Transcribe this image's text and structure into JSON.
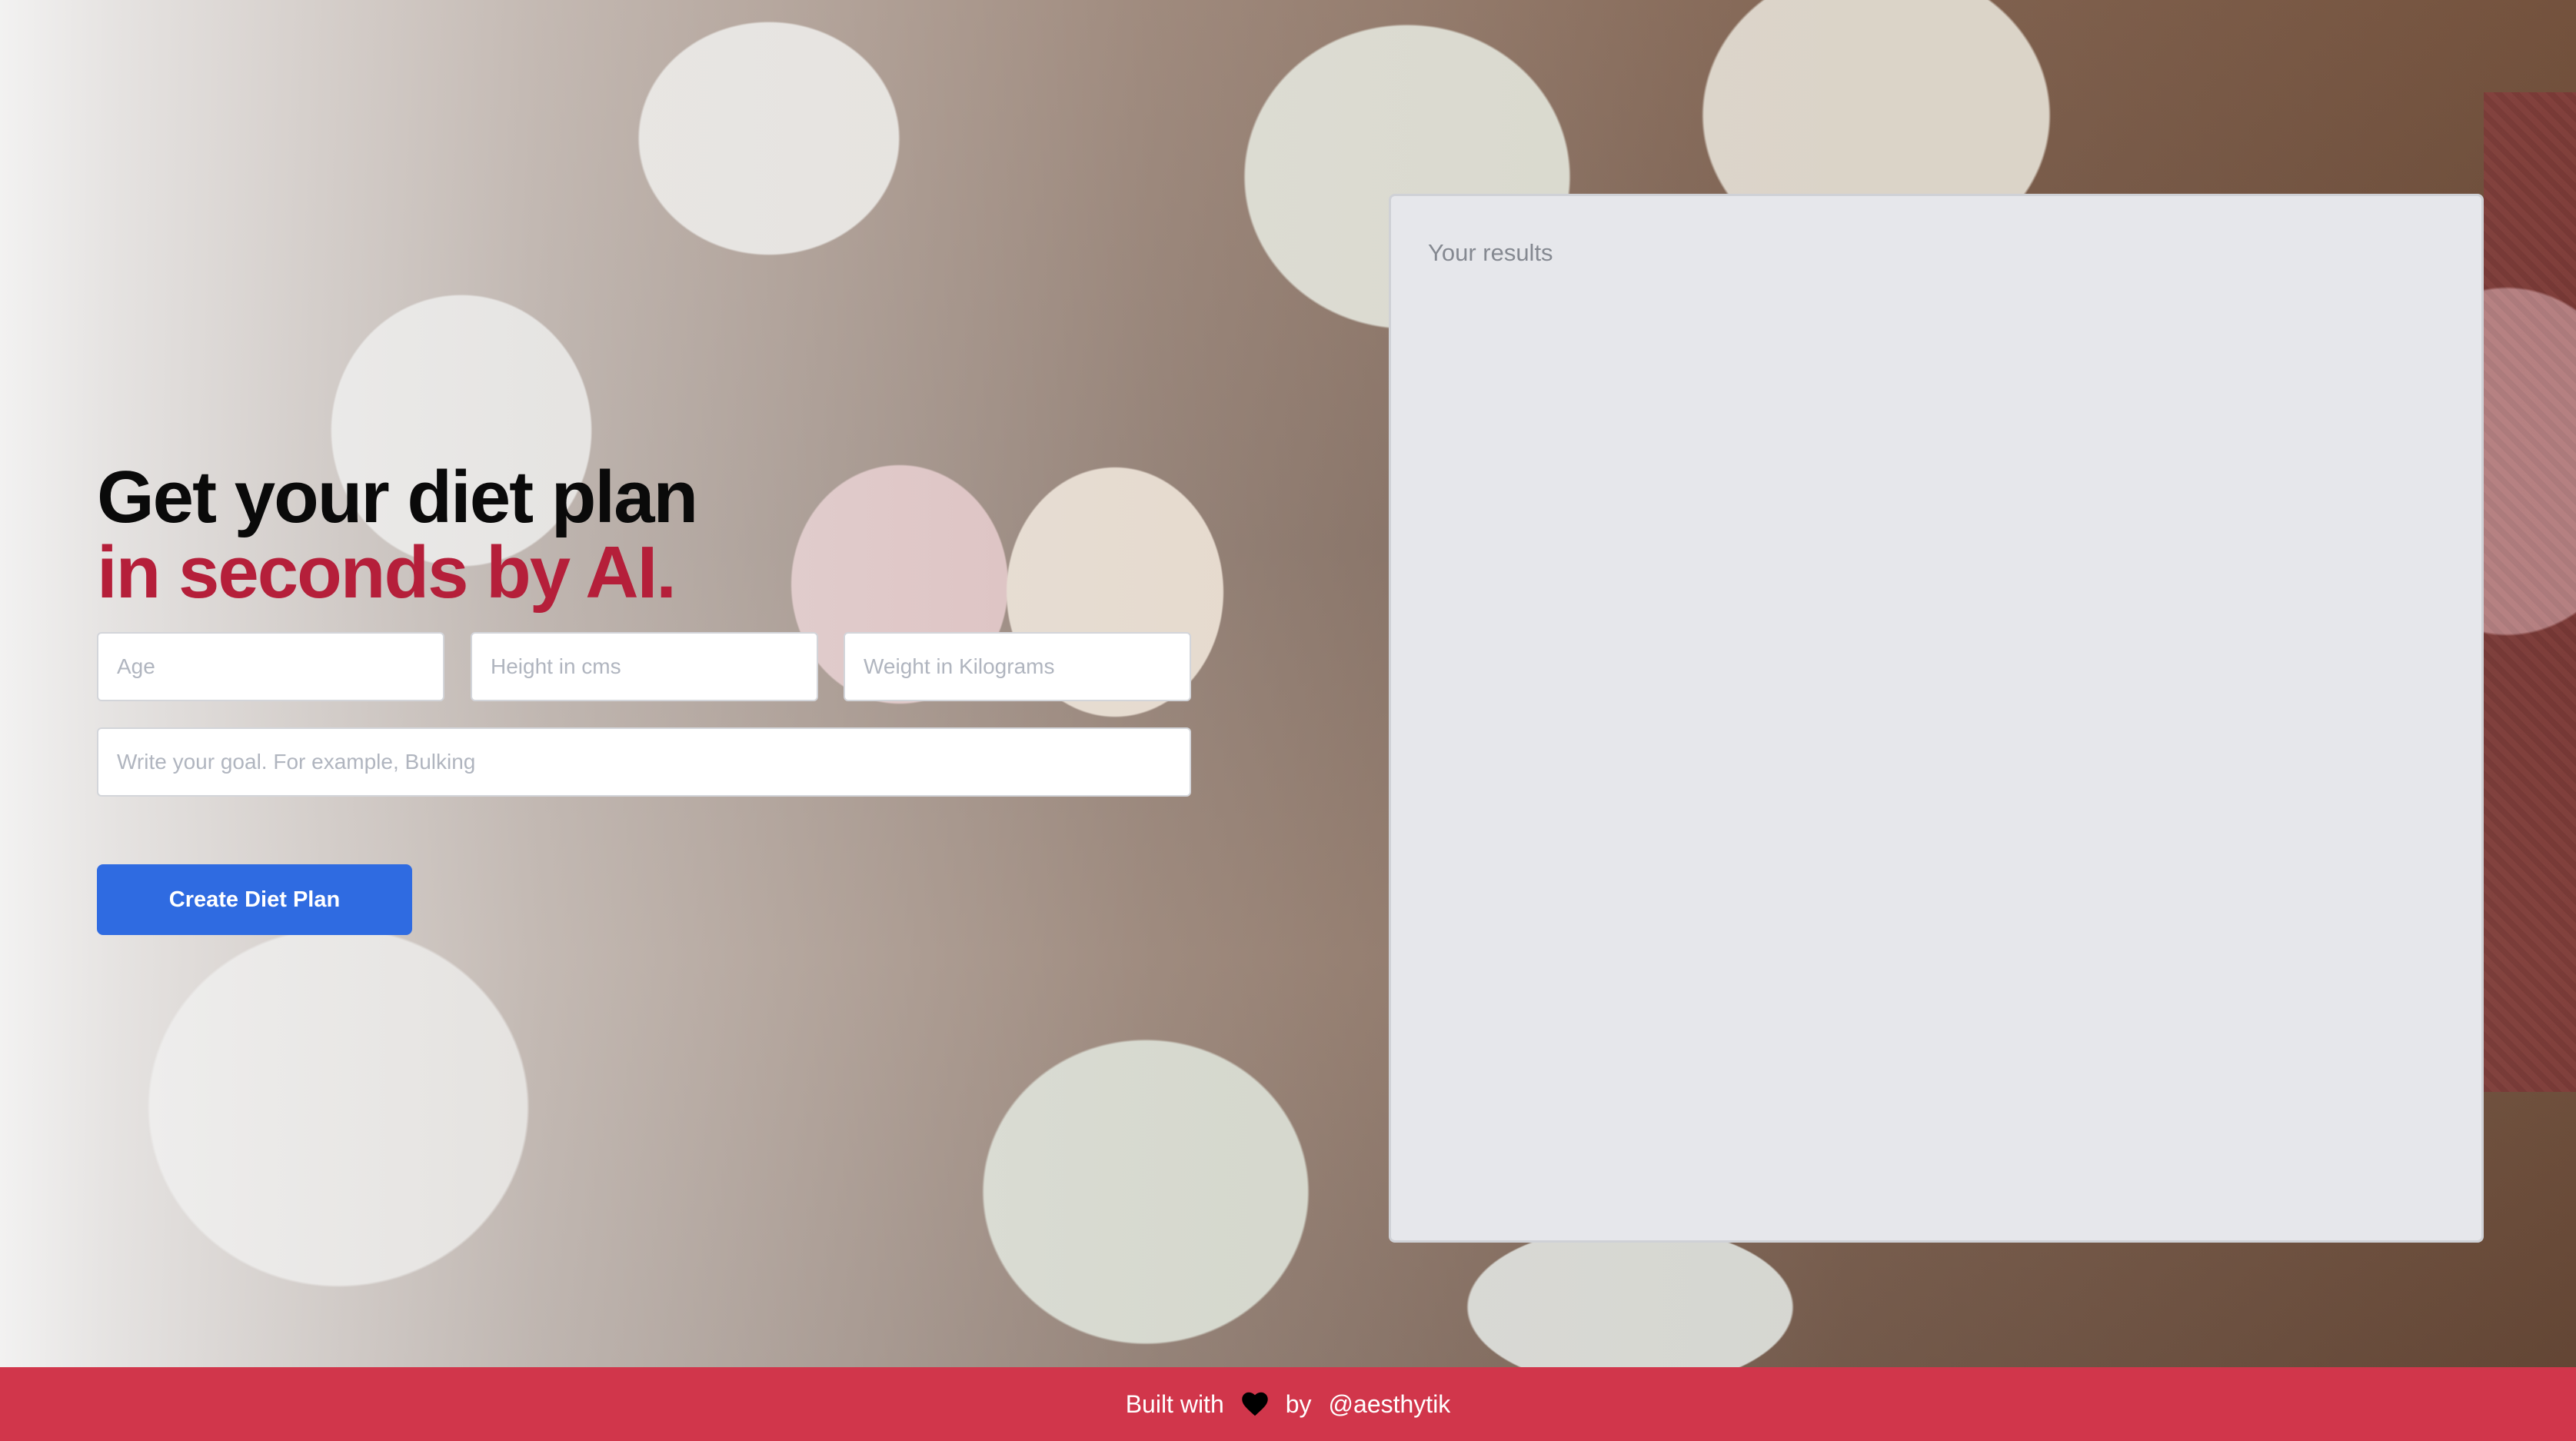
{
  "hero": {
    "title_line1": "Get your diet plan",
    "title_line2": "in seconds by AI."
  },
  "form": {
    "age": {
      "placeholder": "Age",
      "value": ""
    },
    "height": {
      "placeholder": "Height in cms",
      "value": ""
    },
    "weight": {
      "placeholder": "Weight in Kilograms",
      "value": ""
    },
    "goal": {
      "placeholder": "Write your goal. For example, Bulking",
      "value": ""
    },
    "submit_label": "Create Diet Plan"
  },
  "results": {
    "label": "Your results"
  },
  "footer": {
    "built_with": "Built with",
    "heart_icon": "heart-icon",
    "by": "by",
    "author": "@aesthytik"
  },
  "colors": {
    "accent": "#b51f3a",
    "button": "#2f6be1",
    "footer": "#d1364b"
  }
}
